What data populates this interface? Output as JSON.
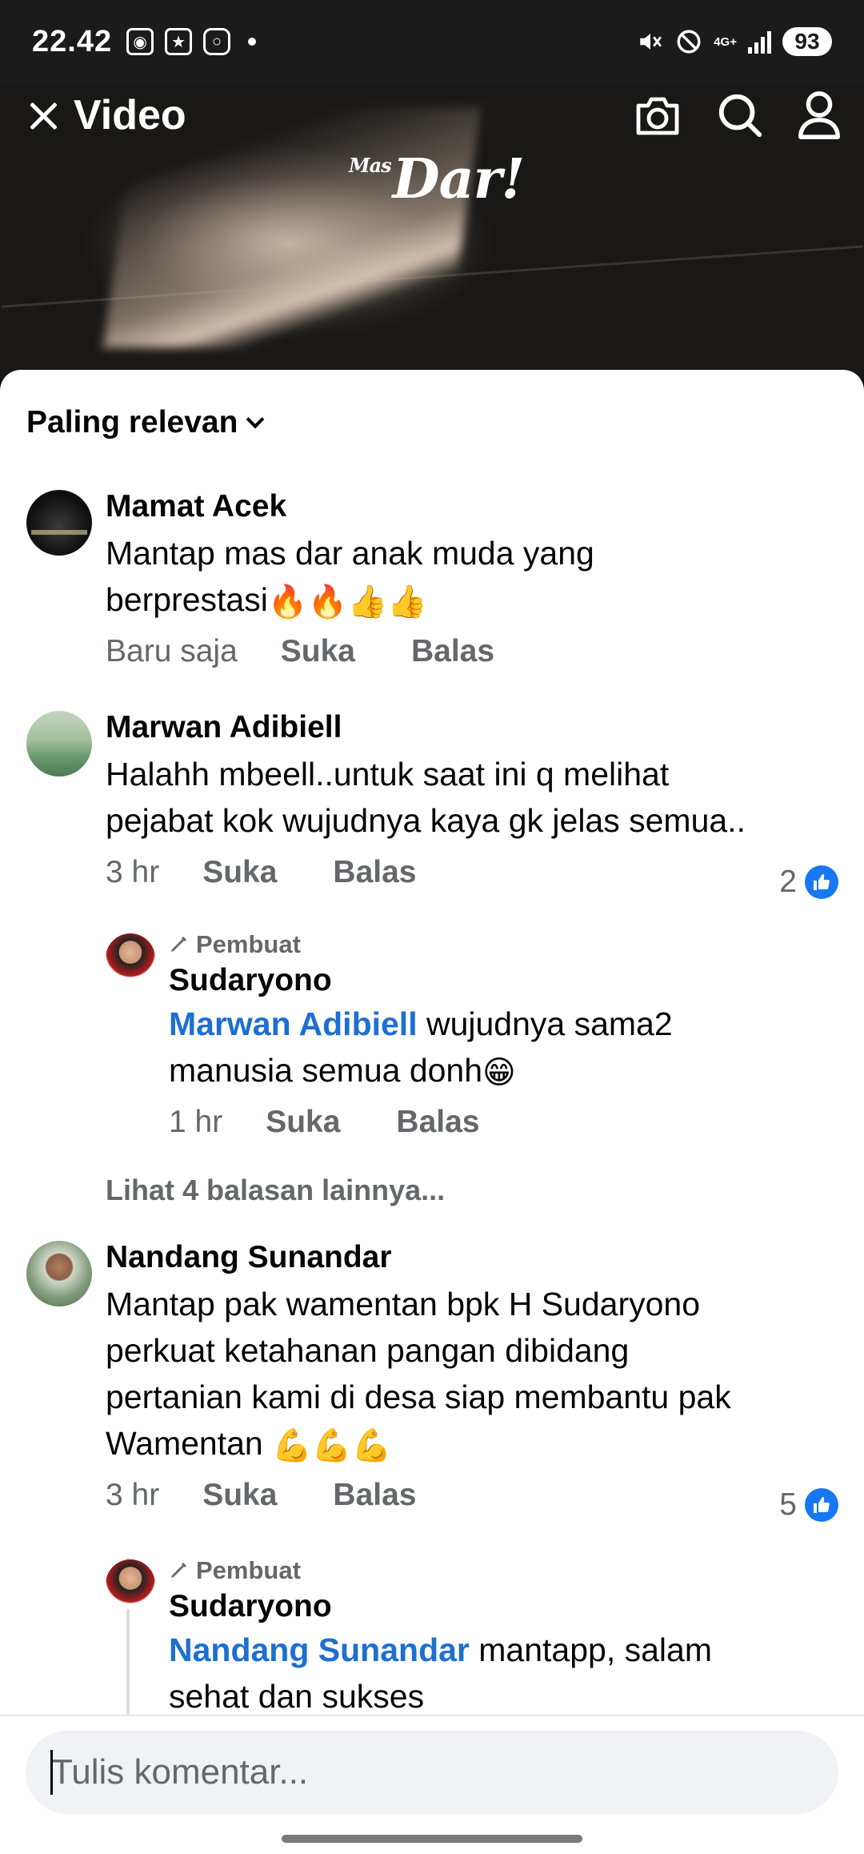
{
  "status_bar": {
    "time": "22.42",
    "net_label": "4G+",
    "battery": "93"
  },
  "video": {
    "title": "Video",
    "logo_small": "Mas",
    "logo_main": "Dar!"
  },
  "sort": {
    "label": "Paling relevan"
  },
  "comments": [
    {
      "name": "Mamat Acek",
      "text_line1": "Mantap mas dar anak muda yang",
      "text_line2": "berprestasi",
      "emoji": "🔥🔥👍👍",
      "time": "Baru saja",
      "like_label": "Suka",
      "reply_label": "Balas"
    },
    {
      "name": "Marwan Adibiell",
      "text_line1": "Halahh mbeell..untuk saat ini q melihat",
      "text_line2": "pejabat kok wujudnya kaya gk jelas semua..",
      "time": "3 hr",
      "like_label": "Suka",
      "reply_label": "Balas",
      "likes": "2",
      "reply": {
        "creator_label": "Pembuat",
        "name": "Sudaryono",
        "mention": "Marwan Adibiell",
        "text_line1": " wujudnya sama2",
        "text_line2": "manusia semua donh",
        "emoji": "😁",
        "time": "1 hr",
        "like_label": "Suka",
        "reply_label": "Balas"
      },
      "more_replies": "Lihat 4 balasan lainnya..."
    },
    {
      "name": "Nandang Sunandar",
      "text_line1": "Mantap pak wamentan bpk H Sudaryono",
      "text_line2": "perkuat ketahanan pangan dibidang",
      "text_line3": "pertanian kami di desa siap membantu pak",
      "text_line4": "Wamentan ",
      "emoji": "💪💪💪",
      "time": "3 hr",
      "like_label": "Suka",
      "reply_label": "Balas",
      "likes": "5",
      "reply": {
        "creator_label": "Pembuat",
        "name": "Sudaryono",
        "mention": "Nandang Sunandar",
        "text_line1": " mantapp, salam",
        "text_line2": "sehat dan sukses"
      }
    }
  ],
  "composer": {
    "placeholder": "Tulis komentar..."
  }
}
